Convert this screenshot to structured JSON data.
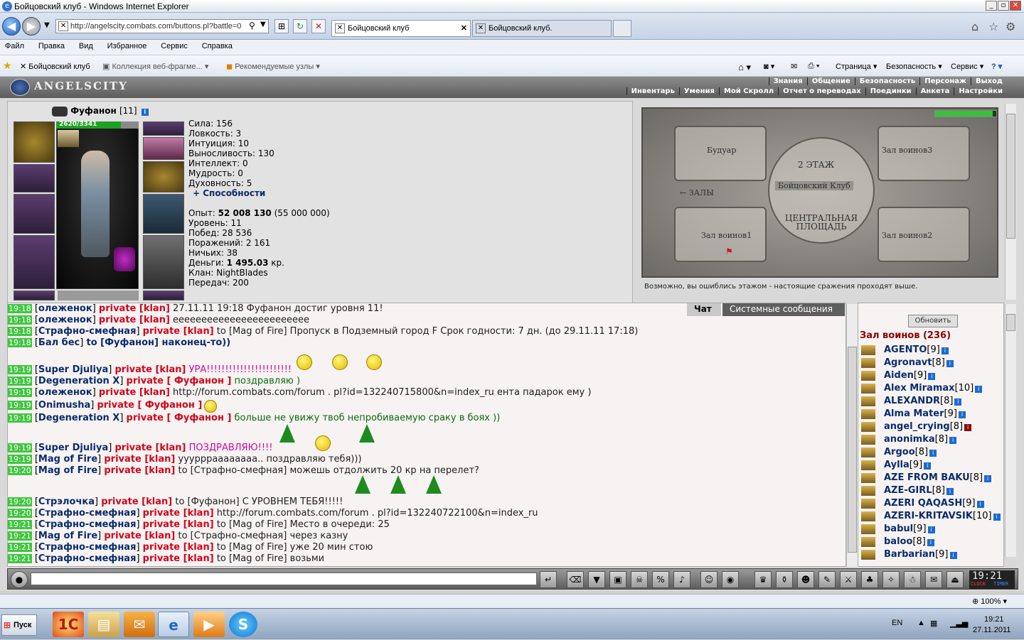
{
  "window": {
    "title": "Бойцовский клуб - Windows Internet Explorer",
    "url": "http://angelscity.combats.com/buttons.pl?battle=0",
    "tabs": [
      "Бойцовский клуб",
      "Бойцовский клуб."
    ],
    "menu": [
      "Файл",
      "Правка",
      "Вид",
      "Избранное",
      "Сервис",
      "Справка"
    ],
    "favorites": [
      "Бойцовский клуб",
      "Коллекция веб-фрагме...",
      "Рекомендуемые узлы"
    ],
    "cmd": [
      "Страница",
      "Безопасность",
      "Сервис"
    ],
    "zoom": "100%"
  },
  "game": {
    "logo": "ANGELSCITY",
    "top_menu_row1": [
      "Знания",
      "Общение",
      "Безопасность",
      "Персонаж",
      "Выход"
    ],
    "top_menu_row2": [
      "Инвентарь",
      "Умения",
      "Мой Скролл",
      "Отчет о переводах",
      "Поединки",
      "Анкета",
      "Настройки"
    ]
  },
  "character": {
    "name": "Фуфанон",
    "level": "[11]",
    "hp_text": "2620/3341",
    "hp_fraction": 0.784,
    "stats": [
      "Сила: 156",
      "Ловкость: 3",
      "Интуиция: 10",
      "Выносливость: 130",
      "Интеллект: 0",
      "Мудрость: 0",
      "Духовность: 5"
    ],
    "abilities_link": "+ Способности",
    "exp_label": "Опыт: ",
    "exp_value": "52 008 130",
    "exp_next": " (55 000 000)",
    "info": [
      "Уровень: 11",
      "Побед: 28 536",
      "Поражений: 2 161",
      "Ничьих: 38"
    ],
    "money_label": "Деньги: ",
    "money_value": "1 495.03",
    "money_unit": " кр.",
    "clan": "Клан: NightBlades",
    "transfers": "Передач: 200"
  },
  "map": {
    "floor": "2 ЭТАЖ",
    "center": "Бойцовский Клуб",
    "rooms": [
      "Будуар",
      "Зал воинов3",
      "Зал воинов1",
      "Зал воинов2"
    ],
    "halls": "← ЗАЛЫ",
    "square": "ЦЕНТРАЛЬНАЯ ПЛОЩАДЬ",
    "note": "Возможно, вы ошиблись этажом - настоящие сражения проходят выше."
  },
  "chat": {
    "tabs": [
      "Чат",
      "Системные сообщения"
    ],
    "lines": [
      {
        "t": "19:18",
        "n": "олеженок",
        "p": "private [klan]",
        "m": "27.11.11 19:18 Фуфанон достиг уровня 11!"
      },
      {
        "t": "19:18",
        "n": "олеженок",
        "p": "private [klan]",
        "m": "eeeeeeeeeeeeeeeeeeeeeeee"
      },
      {
        "t": "19:18",
        "n": "Страфно-смефная",
        "p": "private [klan]",
        "m": "to [Mag of Fire] Пропуск в Подземный город F Срок годности: 7 дн. (до 29.11.11 17:18)"
      },
      {
        "t": "19:18",
        "n": "Бал бес",
        "p": "",
        "m": "to [Фуфанон] наконец-то))"
      },
      {
        "t": "19:19",
        "n": "Super Djuliya",
        "p": "private [klan]",
        "m": "УРА!!!!!!!!!!!!!!!!!!!!!!!"
      },
      {
        "t": "19:19",
        "n": "Degeneration X",
        "p": "private [ Фуфанон ]",
        "m": "поздравляю )"
      },
      {
        "t": "19:19",
        "n": "олеженок",
        "p": "private [klan]",
        "m": "http://forum.combats.com/forum . pl?id=132240715800&n=index_ru ента падарок ему )"
      },
      {
        "t": "19:19",
        "n": "Onimusha",
        "p": "private [ Фуфанон ]",
        "m": ""
      },
      {
        "t": "19:19",
        "n": "Degeneration X",
        "p": "private [ Фуфанон ]",
        "m": "больше не увижу твоб непробиваемую сраку в боях ))"
      },
      {
        "t": "19:19",
        "n": "Super Djuliya",
        "p": "private [klan]",
        "m": "ПОЗДРАВЛЯЮ!!!!"
      },
      {
        "t": "19:19",
        "n": "Mag of Fire",
        "p": "private [klan]",
        "m": "уууррраааааааа.. поздравляю тебя)))"
      },
      {
        "t": "19:20",
        "n": "Mag of Fire",
        "p": "private [klan]",
        "m": "to [Страфно-смефная] можешь отдолжить 20 кр на перелет?"
      },
      {
        "t": "19:20",
        "n": "Стрэлочка",
        "p": "private [klan]",
        "m": "to [Фуфанон] С УРОВНЕМ ТЕБЯ!!!!!"
      },
      {
        "t": "19:20",
        "n": "Страфно-смефная",
        "p": "private [klan]",
        "m": "http://forum.combats.com/forum . pl?id=132240722100&n=index_ru"
      },
      {
        "t": "19:21",
        "n": "Страфно-смефная",
        "p": "private [klan]",
        "m": "to [Mag of Fire] Место в очереди: 25"
      },
      {
        "t": "19:21",
        "n": "Mag of Fire",
        "p": "private [klan]",
        "m": "to [Страфно-смефная] через казну"
      },
      {
        "t": "19:21",
        "n": "Страфно-смефная",
        "p": "private [klan]",
        "m": "to [Mag of Fire] уже 20 мин стою"
      },
      {
        "t": "19:21",
        "n": "Страфно-смефная",
        "p": "private [klan]",
        "m": "to [Mag of Fire] возьми"
      }
    ]
  },
  "roster": {
    "refresh": "Обновить",
    "title": "Зал воинов (236)",
    "players": [
      {
        "n": "AGENTO",
        "l": "[9]"
      },
      {
        "n": "Agronavt",
        "l": "[8]"
      },
      {
        "n": "Aiden",
        "l": "[9]"
      },
      {
        "n": "Alex Miramax",
        "l": "[10]"
      },
      {
        "n": "ALEXANDR",
        "l": "[8]"
      },
      {
        "n": "Alma Mater",
        "l": "[9]"
      },
      {
        "n": "angel_crying",
        "l": "[8]"
      },
      {
        "n": "anonimka",
        "l": "[8]"
      },
      {
        "n": "Argoo",
        "l": "[8]"
      },
      {
        "n": "Aylla",
        "l": "[9]"
      },
      {
        "n": "AZE FROM BAKU",
        "l": "[8]"
      },
      {
        "n": "AZE-GIRL",
        "l": "[8]"
      },
      {
        "n": "AZERI QAQASH",
        "l": "[9]"
      },
      {
        "n": "AZERI-KRITAVSIK",
        "l": "[10]"
      },
      {
        "n": "babul",
        "l": "[9]"
      },
      {
        "n": "baloo",
        "l": "[8]"
      },
      {
        "n": "Barbarian",
        "l": "[9]"
      }
    ]
  },
  "clock": {
    "time": "19:21",
    "labels": [
      "CLOCK",
      "TIMER"
    ]
  },
  "taskbar": {
    "start": "Пуск",
    "lang": "EN",
    "time": "19:21",
    "date": "27.11.2011"
  }
}
